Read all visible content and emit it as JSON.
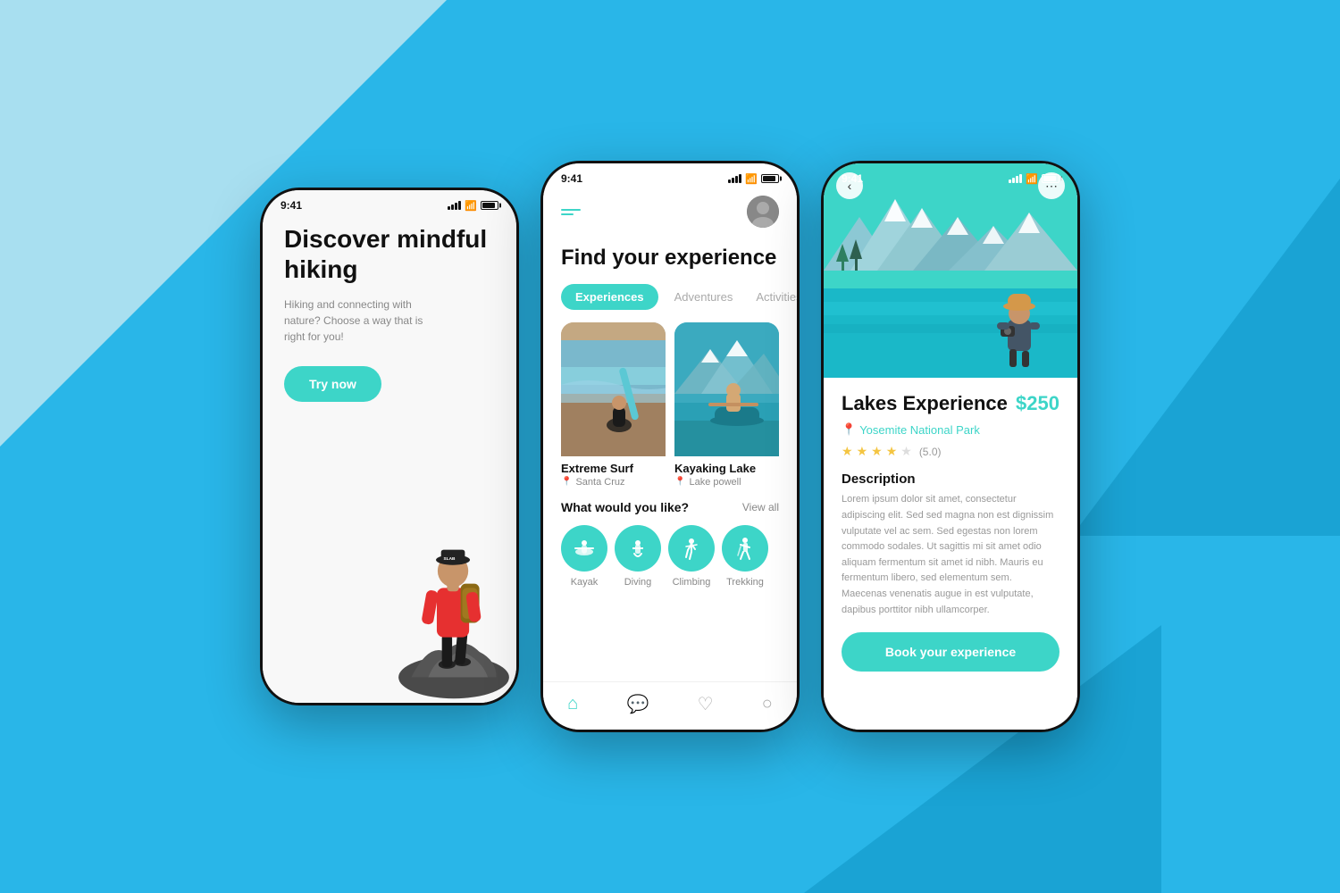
{
  "background_color": "#29b6e8",
  "phone1": {
    "status_time": "9:41",
    "title": "Discover mindful hiking",
    "description": "Hiking and connecting with nature? Choose a way that is right for you!",
    "cta_label": "Try now"
  },
  "phone2": {
    "status_time": "9:41",
    "header_title": "Find your experience",
    "tabs": [
      {
        "label": "Experiences",
        "active": true
      },
      {
        "label": "Adventures",
        "active": false
      },
      {
        "label": "Activities",
        "active": false
      }
    ],
    "cards": [
      {
        "title": "Extreme Surf",
        "location": "Santa Cruz"
      },
      {
        "title": "Kayaking Lake",
        "location": "Lake powell"
      }
    ],
    "section_title": "What would you like?",
    "view_all_label": "View all",
    "activities": [
      {
        "label": "Kayak"
      },
      {
        "label": "Diving"
      },
      {
        "label": "Climbing"
      },
      {
        "label": "Trekking"
      }
    ],
    "nav_items": [
      {
        "label": "home",
        "active": true
      },
      {
        "label": "chat",
        "active": false
      },
      {
        "label": "heart",
        "active": false
      },
      {
        "label": "search",
        "active": false
      }
    ]
  },
  "phone3": {
    "status_time": "9:41",
    "experience_title": "Lakes Experience",
    "price": "$250",
    "location": "Yosemite National Park",
    "rating": 5.0,
    "stars_filled": 4,
    "stars_empty": 1,
    "description_title": "Description",
    "description_text": "Lorem ipsum dolor sit amet, consectetur adipiscing elit. Sed sed magna non est dignissim vulputate vel ac sem. Sed egestas non lorem commodo sodales. Ut sagittis mi sit amet odio aliquam fermentum sit amet id nibh. Mauris eu fermentum libero, sed elementum sem. Maecenas venenatis augue in est vulputate, dapibus porttitor nibh ullamcorper.",
    "book_label": "Book your experience"
  }
}
